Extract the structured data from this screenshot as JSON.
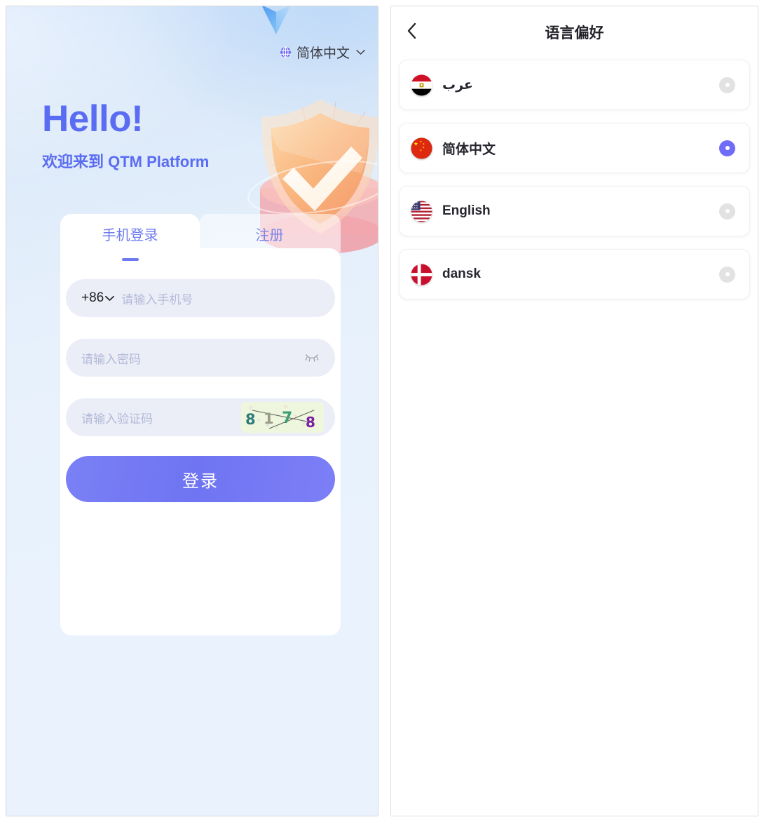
{
  "left": {
    "lang_switch": {
      "label": "简体中文",
      "globe_icon": "globe-icon",
      "chevron_icon": "chevron-down-icon"
    },
    "hero": {
      "title": "Hello!",
      "subtitle": "欢迎来到 QTM Platform"
    },
    "illustration": "shield-check-illustration",
    "tabs": [
      {
        "label": "手机登录",
        "active": true
      },
      {
        "label": "注册",
        "active": false
      }
    ],
    "form": {
      "country_code": "+86",
      "country_code_chevron": "chevron-down-icon",
      "phone_placeholder": "请输入手机号",
      "password_placeholder": "请输入密码",
      "password_toggle_icon": "eye-off-icon",
      "captcha_placeholder": "请输入验证码",
      "captcha_text": "8178",
      "submit_label": "登录"
    }
  },
  "right": {
    "back_icon": "chevron-left-icon",
    "title": "语言偏好",
    "languages": [
      {
        "label": "عرب",
        "flag": "flag-egypt",
        "selected": false,
        "rtl": true
      },
      {
        "label": "简体中文",
        "flag": "flag-china",
        "selected": true,
        "rtl": false
      },
      {
        "label": "English",
        "flag": "flag-usa",
        "selected": false,
        "rtl": false
      },
      {
        "label": "dansk",
        "flag": "flag-denmark",
        "selected": false,
        "rtl": false
      }
    ]
  },
  "colors": {
    "accent": "#6f6cf7",
    "hero_text": "#5a6cf2",
    "panel_bg": "#e9f2fd",
    "field_bg": "#ebedf7",
    "placeholder": "#b3bad8",
    "radio_off": "#e2e2e2"
  }
}
